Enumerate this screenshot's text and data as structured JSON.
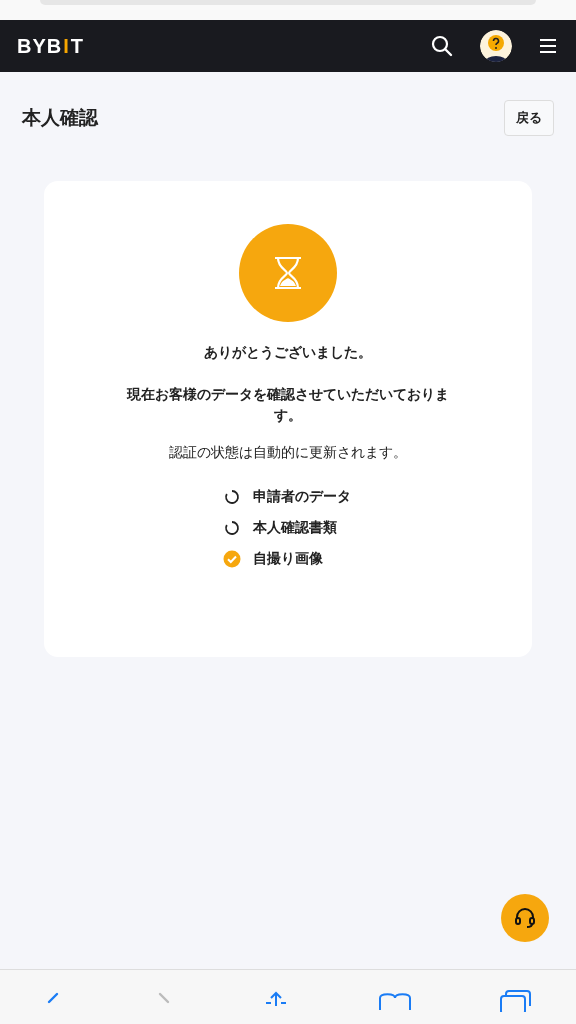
{
  "header": {
    "logo": {
      "start": "BYB",
      "accent": "I",
      "end": "T"
    }
  },
  "page": {
    "title": "本人確認",
    "back_button": "戻る"
  },
  "card": {
    "heading": "ありがとうございました。",
    "message": "現在お客様のデータを確認させていただいております。",
    "note": "認証の状態は自動的に更新されます。",
    "steps": [
      {
        "label": "申請者のデータ",
        "done": false
      },
      {
        "label": "本人確認書類",
        "done": false
      },
      {
        "label": "自撮り画像",
        "done": true
      }
    ]
  },
  "browser_toolbar": {
    "forward_disabled": true
  }
}
